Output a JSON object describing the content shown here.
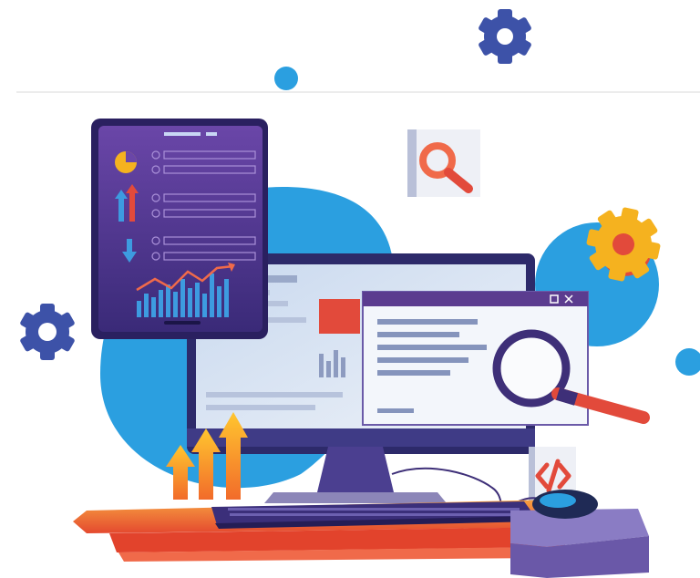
{
  "illustration": {
    "subject": "web-analytics-workstation",
    "icons": [
      "gear-icon",
      "magnifier-icon",
      "pie-chart-icon",
      "up-arrows-icon",
      "down-arrow-icon",
      "code-icon",
      "computer-mouse-icon"
    ],
    "colors": {
      "sky_blue": "#2b9fe0",
      "navy": "#2d3e8a",
      "purple": "#5b3c8f",
      "violet": "#7a4fb5",
      "orange": "#f5a51f",
      "red": "#e24a3b",
      "coral": "#f06a4a",
      "white": "#ffffff",
      "light_gray": "#e9edf3",
      "divider": "#e6e6e6"
    }
  }
}
